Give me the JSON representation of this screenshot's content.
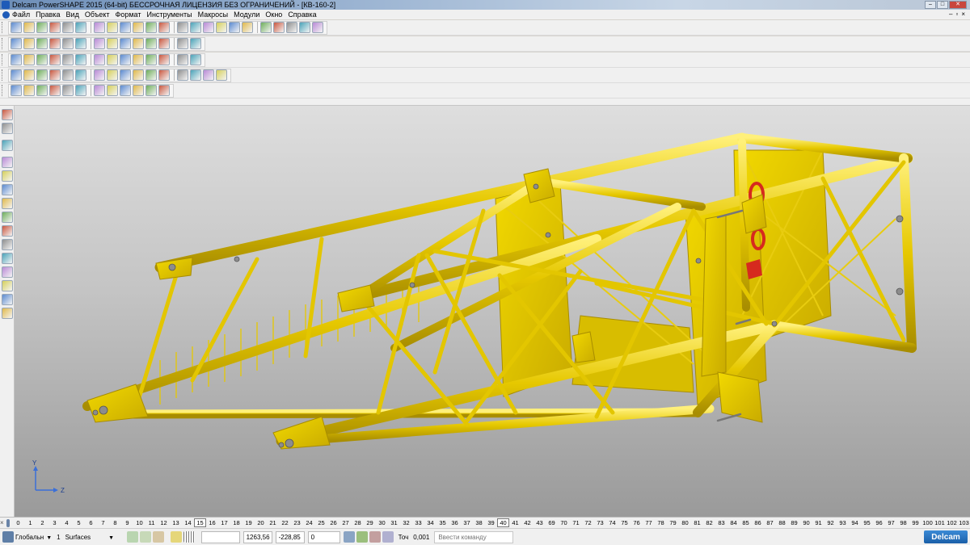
{
  "window": {
    "title": "Delcam PowerSHAPE 2015 (64-bit) БЕССРОЧНАЯ ЛИЦЕНЗИЯ БЕЗ ОГРАНИЧЕНИЙ - [КВ-160-2]",
    "minimize": "–",
    "maximize": "□",
    "close": "✕"
  },
  "menu": {
    "items": [
      "Файл",
      "Правка",
      "Вид",
      "Объект",
      "Формат",
      "Инструменты",
      "Макросы",
      "Модули",
      "Окно",
      "Справка"
    ],
    "mdi_controls": [
      "–",
      "▫",
      "×"
    ]
  },
  "toolbars": {
    "row1_icons": [
      "new-file-icon",
      "open-file-icon",
      "save-icon",
      "save-as-icon",
      "print-icon",
      "cut-icon",
      "copy-icon",
      "paste-icon",
      "eraser-icon",
      "delete-icon",
      "undo-icon",
      "redo-icon",
      "measure-icon",
      "find-icon",
      "select-icon",
      "curve-icon",
      "circle-icon",
      "spline-icon",
      "arrow-icon",
      "surface-icon",
      "solid-icon",
      "layers-icon",
      "wand-icon"
    ],
    "row2_icons": [
      "view-box-icon",
      "view-front-icon",
      "view-iso-icon",
      "view-top-icon",
      "view-side-icon",
      "zoom-fit-icon",
      "zoom-in-icon",
      "zoom-window-icon",
      "zoom-out-icon",
      "globe-icon",
      "shade-icon",
      "wireframe-icon",
      "person-icon",
      "lightbulb-icon"
    ],
    "row3_icons": [
      "calculator-icon",
      "doc-icon",
      "rebuild-icon",
      "shaded-icon",
      "red-sphere-icon",
      "green-sphere-icon",
      "play-icon",
      "triangle-icon",
      "cube-icon",
      "block-icon",
      "box-icon",
      "gallery-icon",
      "frame-icon",
      "puzzle-icon"
    ],
    "row4_icons": [
      "select-mode-icon",
      "arrow-back-icon",
      "cube-group-icon",
      "grid-icon",
      "cube-gray-icon",
      "cylinder-icon",
      "cone-icon",
      "torus-icon",
      "extrude-icon",
      "revolve-icon",
      "fillet-icon",
      "chamfer-icon",
      "shell-icon",
      "boolean-icon",
      "cut-solid-icon",
      "split-icon"
    ],
    "row5_icons": [
      "part-icon",
      "axis-icon",
      "solid-icon",
      "cube-yellow-icon",
      "hole-icon",
      "pocket-icon",
      "boss-icon",
      "measure-solid-icon",
      "palette-icon",
      "tree-icon",
      "gear-icon",
      "light-icon"
    ]
  },
  "left_toolbar_icons": [
    "pointer-icon",
    "select-box-icon",
    "line-icon",
    "warning-icon",
    "curve-left-icon",
    "surface-left-icon",
    "solid-left-icon",
    "fillet-left-icon",
    "tool-left-icon",
    "assembly-left-icon",
    "wire-left-icon",
    "drafting-left-icon",
    "electrode-left-icon",
    "render-left-icon",
    "arrow-left-icon"
  ],
  "axis": {
    "y": "Y",
    "z": "Z"
  },
  "levels": {
    "numbers": [
      "0",
      "1",
      "2",
      "3",
      "4",
      "5",
      "6",
      "7",
      "8",
      "9",
      "10",
      "11",
      "12",
      "13",
      "14",
      "15",
      "16",
      "17",
      "18",
      "19",
      "20",
      "21",
      "22",
      "23",
      "24",
      "25",
      "26",
      "27",
      "28",
      "29",
      "30",
      "31",
      "32",
      "33",
      "34",
      "35",
      "36",
      "37",
      "38",
      "39",
      "40",
      "41",
      "42",
      "43",
      "69",
      "70",
      "71",
      "72",
      "73",
      "74",
      "75",
      "76",
      "77",
      "78",
      "79",
      "80",
      "81",
      "82",
      "83",
      "84",
      "85",
      "86",
      "87",
      "88",
      "89",
      "90",
      "91",
      "92",
      "93",
      "94",
      "95",
      "96",
      "97",
      "98",
      "99",
      "100",
      "101",
      "102",
      "103"
    ],
    "active": [
      "15",
      "40"
    ]
  },
  "status": {
    "workplane": "Глобальн",
    "level_number": "1",
    "level_name": "Surfaces",
    "x": "1263,56",
    "y": "-228,85",
    "z": "0",
    "tolerance_label": "Точ",
    "tolerance": "0,001",
    "command_placeholder": "Ввести команду",
    "logo": "Delcam"
  },
  "colors": {
    "frame_yellow": "#e6c800",
    "frame_highlight": "#fff07a",
    "frame_shadow": "#a88d00",
    "accent_red": "#d62a1e"
  }
}
